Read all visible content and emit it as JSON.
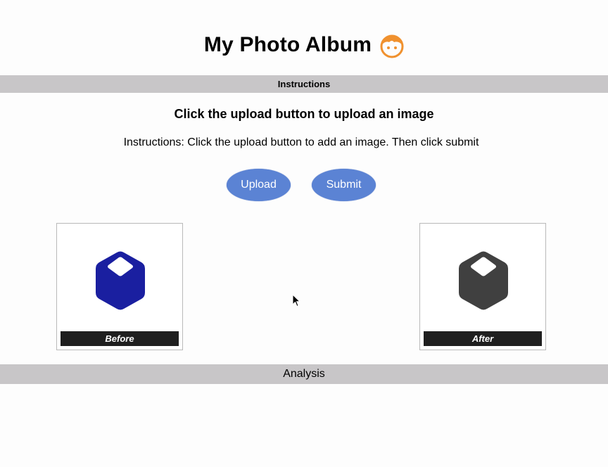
{
  "header": {
    "title": "My Photo Album",
    "icon": "face-icon"
  },
  "instructions_bar": {
    "label": "Instructions"
  },
  "main": {
    "heading": "Click the upload button to upload an image",
    "instruction_text": "Instructions: Click the upload button to add an image. Then click submit",
    "upload_label": "Upload",
    "submit_label": "Submit"
  },
  "images": {
    "before": {
      "caption": "Before",
      "icon": "cube-icon",
      "color": "#1a1fa0"
    },
    "after": {
      "caption": "After",
      "icon": "cube-icon",
      "color": "#404040"
    }
  },
  "analysis_bar": {
    "label": "Analysis"
  },
  "colors": {
    "button": "#5b83d4",
    "bar": "#c8c6c8",
    "face": "#f0912e"
  }
}
